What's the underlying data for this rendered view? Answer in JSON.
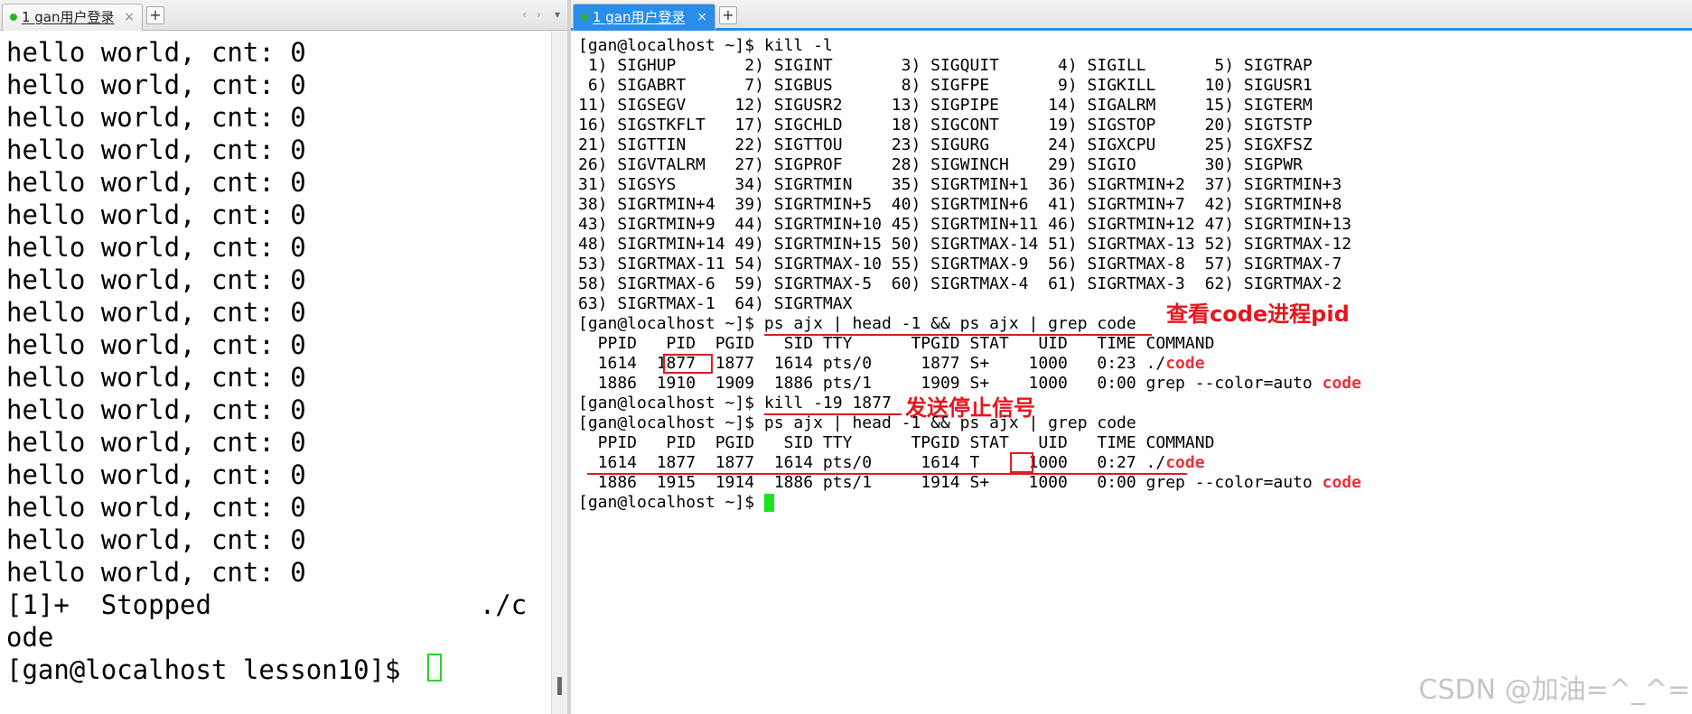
{
  "tabs": {
    "left": {
      "title": "1 gan用户登录",
      "close": "×",
      "add": "+",
      "status_color": "#2fb12f"
    },
    "right": {
      "title": "1 gan用户登录",
      "close": "×",
      "add": "+",
      "status_color": "#2fb12f"
    },
    "nav": {
      "prev": "‹",
      "next": "›",
      "menu": "▾"
    }
  },
  "left_terminal": {
    "lines": [
      "hello world, cnt: 0",
      "hello world, cnt: 0",
      "hello world, cnt: 0",
      "hello world, cnt: 0",
      "hello world, cnt: 0",
      "hello world, cnt: 0",
      "hello world, cnt: 0",
      "hello world, cnt: 0",
      "hello world, cnt: 0",
      "hello world, cnt: 0",
      "hello world, cnt: 0",
      "hello world, cnt: 0",
      "hello world, cnt: 0",
      "hello world, cnt: 0",
      "hello world, cnt: 0",
      "hello world, cnt: 0",
      "hello world, cnt: 0",
      "[1]+  Stopped                 ./c",
      "ode",
      "[gan@localhost lesson10]$ "
    ]
  },
  "right_terminal": {
    "prompt": "[gan@localhost ~]$ ",
    "cmd_kill_list": "kill -l",
    "signal_lines": [
      " 1) SIGHUP       2) SIGINT       3) SIGQUIT      4) SIGILL       5) SIGTRAP",
      " 6) SIGABRT      7) SIGBUS       8) SIGFPE       9) SIGKILL     10) SIGUSR1",
      "11) SIGSEGV     12) SIGUSR2     13) SIGPIPE     14) SIGALRM     15) SIGTERM",
      "16) SIGSTKFLT   17) SIGCHLD     18) SIGCONT     19) SIGSTOP     20) SIGTSTP",
      "21) SIGTTIN     22) SIGTTOU     23) SIGURG      24) SIGXCPU     25) SIGXFSZ",
      "26) SIGVTALRM   27) SIGPROF     28) SIGWINCH    29) SIGIO       30) SIGPWR",
      "31) SIGSYS      34) SIGRTMIN    35) SIGRTMIN+1  36) SIGRTMIN+2  37) SIGRTMIN+3",
      "38) SIGRTMIN+4  39) SIGRTMIN+5  40) SIGRTMIN+6  41) SIGRTMIN+7  42) SIGRTMIN+8",
      "43) SIGRTMIN+9  44) SIGRTMIN+10 45) SIGRTMIN+11 46) SIGRTMIN+12 47) SIGRTMIN+13",
      "48) SIGRTMIN+14 49) SIGRTMIN+15 50) SIGRTMAX-14 51) SIGRTMAX-13 52) SIGRTMAX-12",
      "53) SIGRTMAX-11 54) SIGRTMAX-10 55) SIGRTMAX-9  56) SIGRTMAX-8  57) SIGRTMAX-7",
      "58) SIGRTMAX-6  59) SIGRTMAX-5  60) SIGRTMAX-4  61) SIGRTMAX-3  62) SIGRTMAX-2",
      "63) SIGRTMAX-1  64) SIGRTMAX"
    ],
    "cmd_ps": "ps ajx | head -1 && ps ajx | grep code",
    "ps_header": "  PPID   PID  PGID   SID TTY      TPGID STAT   UID   TIME COMMAND",
    "ps1_row1": "  1614  1877  1877  1614 pts/0     1877 S+    1000   0:23 ./",
    "ps1_row2": "  1886  1910  1909  1886 pts/1     1909 S+    1000   0:00 grep --color=auto ",
    "cmd_kill_stop": "kill -19 1877",
    "ps2_row1": "  1614  1877  1877  1614 pts/0     1614 T     1000   0:27 ./",
    "ps2_row2": "  1886  1915  1914  1886 pts/1     1914 S+    1000   0:00 grep --color=auto ",
    "code_word": "code"
  },
  "annotations": {
    "view_pid": "查看code进程pid",
    "send_stop": "发送停止信号",
    "color": "#e8141c"
  },
  "watermark": "CSDN @加油=^_^="
}
